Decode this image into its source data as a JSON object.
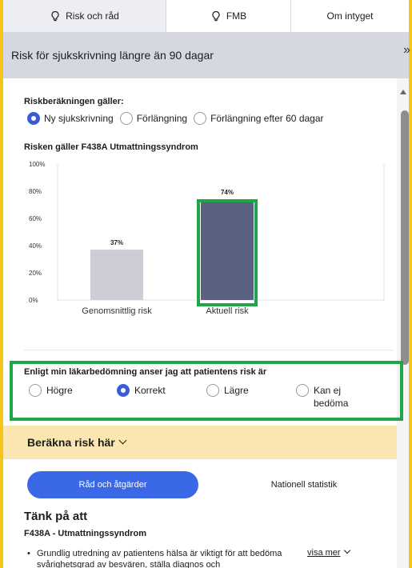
{
  "tabs": [
    {
      "label": "Risk och råd",
      "icon": "lightbulb-icon"
    },
    {
      "label": "FMB",
      "icon": "lightbulb-icon"
    },
    {
      "label": "Om intyget"
    }
  ],
  "header": {
    "title": "Risk för sjukskrivning längre än 90 dagar",
    "expand_icon": "double-chevron-right-icon"
  },
  "calculation": {
    "title": "Riskberäkningen gäller:",
    "options": [
      "Ny sjukskrivning",
      "Förlängning",
      "Förlängning efter 60 dagar"
    ],
    "selected": "Ny sjukskrivning"
  },
  "risk_title": "Risken gäller F438A Utmattningssyndrom",
  "chart_data": {
    "type": "bar",
    "categories": [
      "Genomsnittlig risk",
      "Aktuell risk"
    ],
    "values": [
      37,
      74
    ],
    "value_labels": [
      "37%",
      "74%"
    ],
    "yticks": [
      "100%",
      "80%",
      "60%",
      "40%",
      "20%",
      "0%"
    ],
    "ylim": [
      0,
      100
    ],
    "colors": [
      "#cdcdd6",
      "#5b6181"
    ]
  },
  "assessment": {
    "title": "Enligt min läkarbedömning anser jag att patientens risk är",
    "options": [
      "Högre",
      "Korrekt",
      "Lägre",
      "Kan ej bedöma"
    ],
    "selected": "Korrekt"
  },
  "calc_band": {
    "label": "Beräkna risk här"
  },
  "actions": {
    "primary": "Råd och åtgärder",
    "secondary": "Nationell statistik"
  },
  "think": {
    "title": "Tänk på att",
    "diagnosis": "F438A - Utmattningssyndrom",
    "bullet": "Grundlig utredning av patientens hälsa är viktigt för att bedöma svårighetsgrad av besvären, ställa diagnos och",
    "more": "visa mer"
  },
  "colors": {
    "frame": "#f5c518",
    "highlight": "#1fa64a",
    "accent": "#3a68e6",
    "band": "#fbe5b0"
  }
}
